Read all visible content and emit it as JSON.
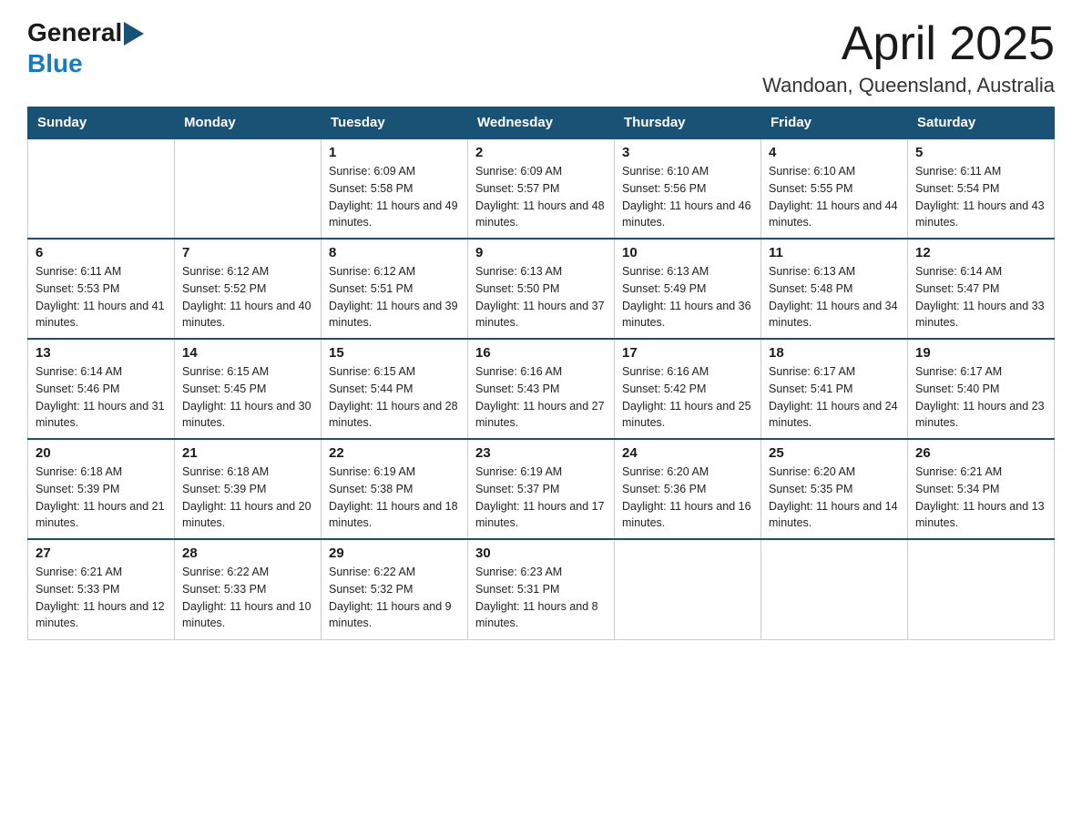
{
  "header": {
    "logo_general": "General",
    "logo_blue": "Blue",
    "title": "April 2025",
    "location": "Wandoan, Queensland, Australia"
  },
  "days_of_week": [
    "Sunday",
    "Monday",
    "Tuesday",
    "Wednesday",
    "Thursday",
    "Friday",
    "Saturday"
  ],
  "weeks": [
    [
      {
        "day": "",
        "sunrise": "",
        "sunset": "",
        "daylight": ""
      },
      {
        "day": "",
        "sunrise": "",
        "sunset": "",
        "daylight": ""
      },
      {
        "day": "1",
        "sunrise": "Sunrise: 6:09 AM",
        "sunset": "Sunset: 5:58 PM",
        "daylight": "Daylight: 11 hours and 49 minutes."
      },
      {
        "day": "2",
        "sunrise": "Sunrise: 6:09 AM",
        "sunset": "Sunset: 5:57 PM",
        "daylight": "Daylight: 11 hours and 48 minutes."
      },
      {
        "day": "3",
        "sunrise": "Sunrise: 6:10 AM",
        "sunset": "Sunset: 5:56 PM",
        "daylight": "Daylight: 11 hours and 46 minutes."
      },
      {
        "day": "4",
        "sunrise": "Sunrise: 6:10 AM",
        "sunset": "Sunset: 5:55 PM",
        "daylight": "Daylight: 11 hours and 44 minutes."
      },
      {
        "day": "5",
        "sunrise": "Sunrise: 6:11 AM",
        "sunset": "Sunset: 5:54 PM",
        "daylight": "Daylight: 11 hours and 43 minutes."
      }
    ],
    [
      {
        "day": "6",
        "sunrise": "Sunrise: 6:11 AM",
        "sunset": "Sunset: 5:53 PM",
        "daylight": "Daylight: 11 hours and 41 minutes."
      },
      {
        "day": "7",
        "sunrise": "Sunrise: 6:12 AM",
        "sunset": "Sunset: 5:52 PM",
        "daylight": "Daylight: 11 hours and 40 minutes."
      },
      {
        "day": "8",
        "sunrise": "Sunrise: 6:12 AM",
        "sunset": "Sunset: 5:51 PM",
        "daylight": "Daylight: 11 hours and 39 minutes."
      },
      {
        "day": "9",
        "sunrise": "Sunrise: 6:13 AM",
        "sunset": "Sunset: 5:50 PM",
        "daylight": "Daylight: 11 hours and 37 minutes."
      },
      {
        "day": "10",
        "sunrise": "Sunrise: 6:13 AM",
        "sunset": "Sunset: 5:49 PM",
        "daylight": "Daylight: 11 hours and 36 minutes."
      },
      {
        "day": "11",
        "sunrise": "Sunrise: 6:13 AM",
        "sunset": "Sunset: 5:48 PM",
        "daylight": "Daylight: 11 hours and 34 minutes."
      },
      {
        "day": "12",
        "sunrise": "Sunrise: 6:14 AM",
        "sunset": "Sunset: 5:47 PM",
        "daylight": "Daylight: 11 hours and 33 minutes."
      }
    ],
    [
      {
        "day": "13",
        "sunrise": "Sunrise: 6:14 AM",
        "sunset": "Sunset: 5:46 PM",
        "daylight": "Daylight: 11 hours and 31 minutes."
      },
      {
        "day": "14",
        "sunrise": "Sunrise: 6:15 AM",
        "sunset": "Sunset: 5:45 PM",
        "daylight": "Daylight: 11 hours and 30 minutes."
      },
      {
        "day": "15",
        "sunrise": "Sunrise: 6:15 AM",
        "sunset": "Sunset: 5:44 PM",
        "daylight": "Daylight: 11 hours and 28 minutes."
      },
      {
        "day": "16",
        "sunrise": "Sunrise: 6:16 AM",
        "sunset": "Sunset: 5:43 PM",
        "daylight": "Daylight: 11 hours and 27 minutes."
      },
      {
        "day": "17",
        "sunrise": "Sunrise: 6:16 AM",
        "sunset": "Sunset: 5:42 PM",
        "daylight": "Daylight: 11 hours and 25 minutes."
      },
      {
        "day": "18",
        "sunrise": "Sunrise: 6:17 AM",
        "sunset": "Sunset: 5:41 PM",
        "daylight": "Daylight: 11 hours and 24 minutes."
      },
      {
        "day": "19",
        "sunrise": "Sunrise: 6:17 AM",
        "sunset": "Sunset: 5:40 PM",
        "daylight": "Daylight: 11 hours and 23 minutes."
      }
    ],
    [
      {
        "day": "20",
        "sunrise": "Sunrise: 6:18 AM",
        "sunset": "Sunset: 5:39 PM",
        "daylight": "Daylight: 11 hours and 21 minutes."
      },
      {
        "day": "21",
        "sunrise": "Sunrise: 6:18 AM",
        "sunset": "Sunset: 5:39 PM",
        "daylight": "Daylight: 11 hours and 20 minutes."
      },
      {
        "day": "22",
        "sunrise": "Sunrise: 6:19 AM",
        "sunset": "Sunset: 5:38 PM",
        "daylight": "Daylight: 11 hours and 18 minutes."
      },
      {
        "day": "23",
        "sunrise": "Sunrise: 6:19 AM",
        "sunset": "Sunset: 5:37 PM",
        "daylight": "Daylight: 11 hours and 17 minutes."
      },
      {
        "day": "24",
        "sunrise": "Sunrise: 6:20 AM",
        "sunset": "Sunset: 5:36 PM",
        "daylight": "Daylight: 11 hours and 16 minutes."
      },
      {
        "day": "25",
        "sunrise": "Sunrise: 6:20 AM",
        "sunset": "Sunset: 5:35 PM",
        "daylight": "Daylight: 11 hours and 14 minutes."
      },
      {
        "day": "26",
        "sunrise": "Sunrise: 6:21 AM",
        "sunset": "Sunset: 5:34 PM",
        "daylight": "Daylight: 11 hours and 13 minutes."
      }
    ],
    [
      {
        "day": "27",
        "sunrise": "Sunrise: 6:21 AM",
        "sunset": "Sunset: 5:33 PM",
        "daylight": "Daylight: 11 hours and 12 minutes."
      },
      {
        "day": "28",
        "sunrise": "Sunrise: 6:22 AM",
        "sunset": "Sunset: 5:33 PM",
        "daylight": "Daylight: 11 hours and 10 minutes."
      },
      {
        "day": "29",
        "sunrise": "Sunrise: 6:22 AM",
        "sunset": "Sunset: 5:32 PM",
        "daylight": "Daylight: 11 hours and 9 minutes."
      },
      {
        "day": "30",
        "sunrise": "Sunrise: 6:23 AM",
        "sunset": "Sunset: 5:31 PM",
        "daylight": "Daylight: 11 hours and 8 minutes."
      },
      {
        "day": "",
        "sunrise": "",
        "sunset": "",
        "daylight": ""
      },
      {
        "day": "",
        "sunrise": "",
        "sunset": "",
        "daylight": ""
      },
      {
        "day": "",
        "sunrise": "",
        "sunset": "",
        "daylight": ""
      }
    ]
  ]
}
